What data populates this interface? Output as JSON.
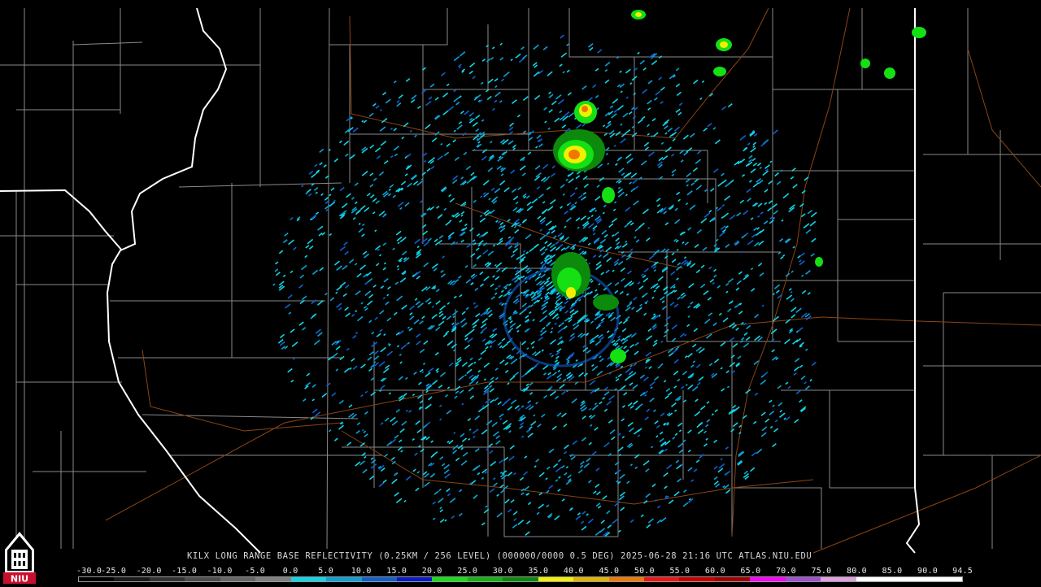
{
  "caption": "KILX LONG RANGE BASE REFLECTIVITY (0.25KM / 256 LEVEL) (000000/0000 0.5 DEG) 2025-06-28 21:16 UTC  ATLAS.NIU.EDU",
  "logo": {
    "text": "NIU",
    "icon": "university-tower-icon",
    "color": "#c8102e"
  },
  "scale": {
    "labels": [
      "-30.0",
      "-25.0",
      "-20.0",
      "-15.0",
      "-10.0",
      "-5.0",
      "0.0",
      "5.0",
      "10.0",
      "15.0",
      "20.0",
      "25.0",
      "30.0",
      "35.0",
      "40.0",
      "45.0",
      "50.0",
      "55.0",
      "60.0",
      "65.0",
      "70.0",
      "75.0",
      "80.0",
      "85.0",
      "90.0",
      "94.5"
    ],
    "colors": [
      "#000000",
      "#1a1a1a",
      "#333333",
      "#4d4d4d",
      "#666666",
      "#808080",
      "#0fd6e6",
      "#0aa2d6",
      "#1060d0",
      "#0a18c8",
      "#14e014",
      "#0fb40f",
      "#0b8a0b",
      "#f0f000",
      "#e0b400",
      "#f07800",
      "#f01414",
      "#c80000",
      "#a00000",
      "#ff00ff",
      "#a050d0",
      "#e0a0e0",
      "#ffffff",
      "#ffffff",
      "#ffffff"
    ]
  },
  "colors": {
    "background": "#000000",
    "county_lines": "#8a8a8a",
    "state_lines": "#ffffff",
    "roads": "#8b4513"
  }
}
